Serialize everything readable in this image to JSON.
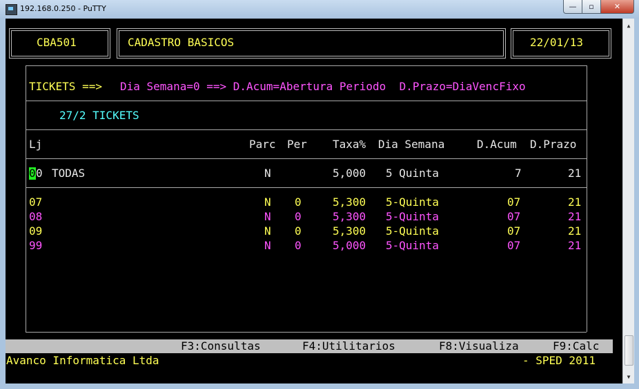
{
  "window": {
    "title": "192.168.0.250 - PuTTY",
    "minimize_glyph": "—",
    "maximize_glyph": "▫",
    "close_glyph": "✕"
  },
  "header": {
    "program_code": "CBA501",
    "screen_title": "CADASTRO BASICOS",
    "date": "22/01/13"
  },
  "info_line": {
    "prefix": "TICKETS ==>",
    "rule": "Dia Semana=0 ==> D.Acum=Abertura Periodo  D.Prazo=DiaVencFixo"
  },
  "subtitle": "27/2 TICKETS",
  "columns": {
    "lj": "Lj",
    "parc": "Parc",
    "per": "Per",
    "taxa": "Taxa%",
    "dia_semana": "Dia Semana",
    "d_acum": "D.Acum",
    "d_prazo": "D.Prazo"
  },
  "default_row": {
    "lj_cursor": "0",
    "lj_rest": "0",
    "name": "TODAS",
    "parc": "N",
    "taxa": "5,000",
    "dia_semana": "5 Quinta",
    "d_acum": "7",
    "d_prazo": "21"
  },
  "rows": [
    {
      "lj": "07",
      "parc": "N",
      "per": "0",
      "taxa": "5,300",
      "dia_semana": "5-Quinta",
      "d_acum": "07",
      "d_prazo": "21",
      "color": "#ffff55"
    },
    {
      "lj": "08",
      "parc": "N",
      "per": "0",
      "taxa": "5,300",
      "dia_semana": "5-Quinta",
      "d_acum": "07",
      "d_prazo": "21",
      "color": "#ff55ff"
    },
    {
      "lj": "09",
      "parc": "N",
      "per": "0",
      "taxa": "5,300",
      "dia_semana": "5-Quinta",
      "d_acum": "07",
      "d_prazo": "21",
      "color": "#ffff55"
    },
    {
      "lj": "99",
      "parc": "N",
      "per": "0",
      "taxa": "5,000",
      "dia_semana": "5-Quinta",
      "d_acum": "07",
      "d_prazo": "21",
      "color": "#ff55ff"
    }
  ],
  "function_keys": {
    "f3": "F3:Consultas",
    "f4": "F4:Utilitarios",
    "f8": "F8:Visualiza",
    "f9": "F9:Calc"
  },
  "footer": {
    "company": "Avanco Informatica Ltda",
    "system": "- SPED 2011"
  },
  "colors": {
    "yellow": "#ffff55",
    "magenta": "#ff55ff",
    "cyan": "#55ffff",
    "cursor": "#22ee22"
  }
}
